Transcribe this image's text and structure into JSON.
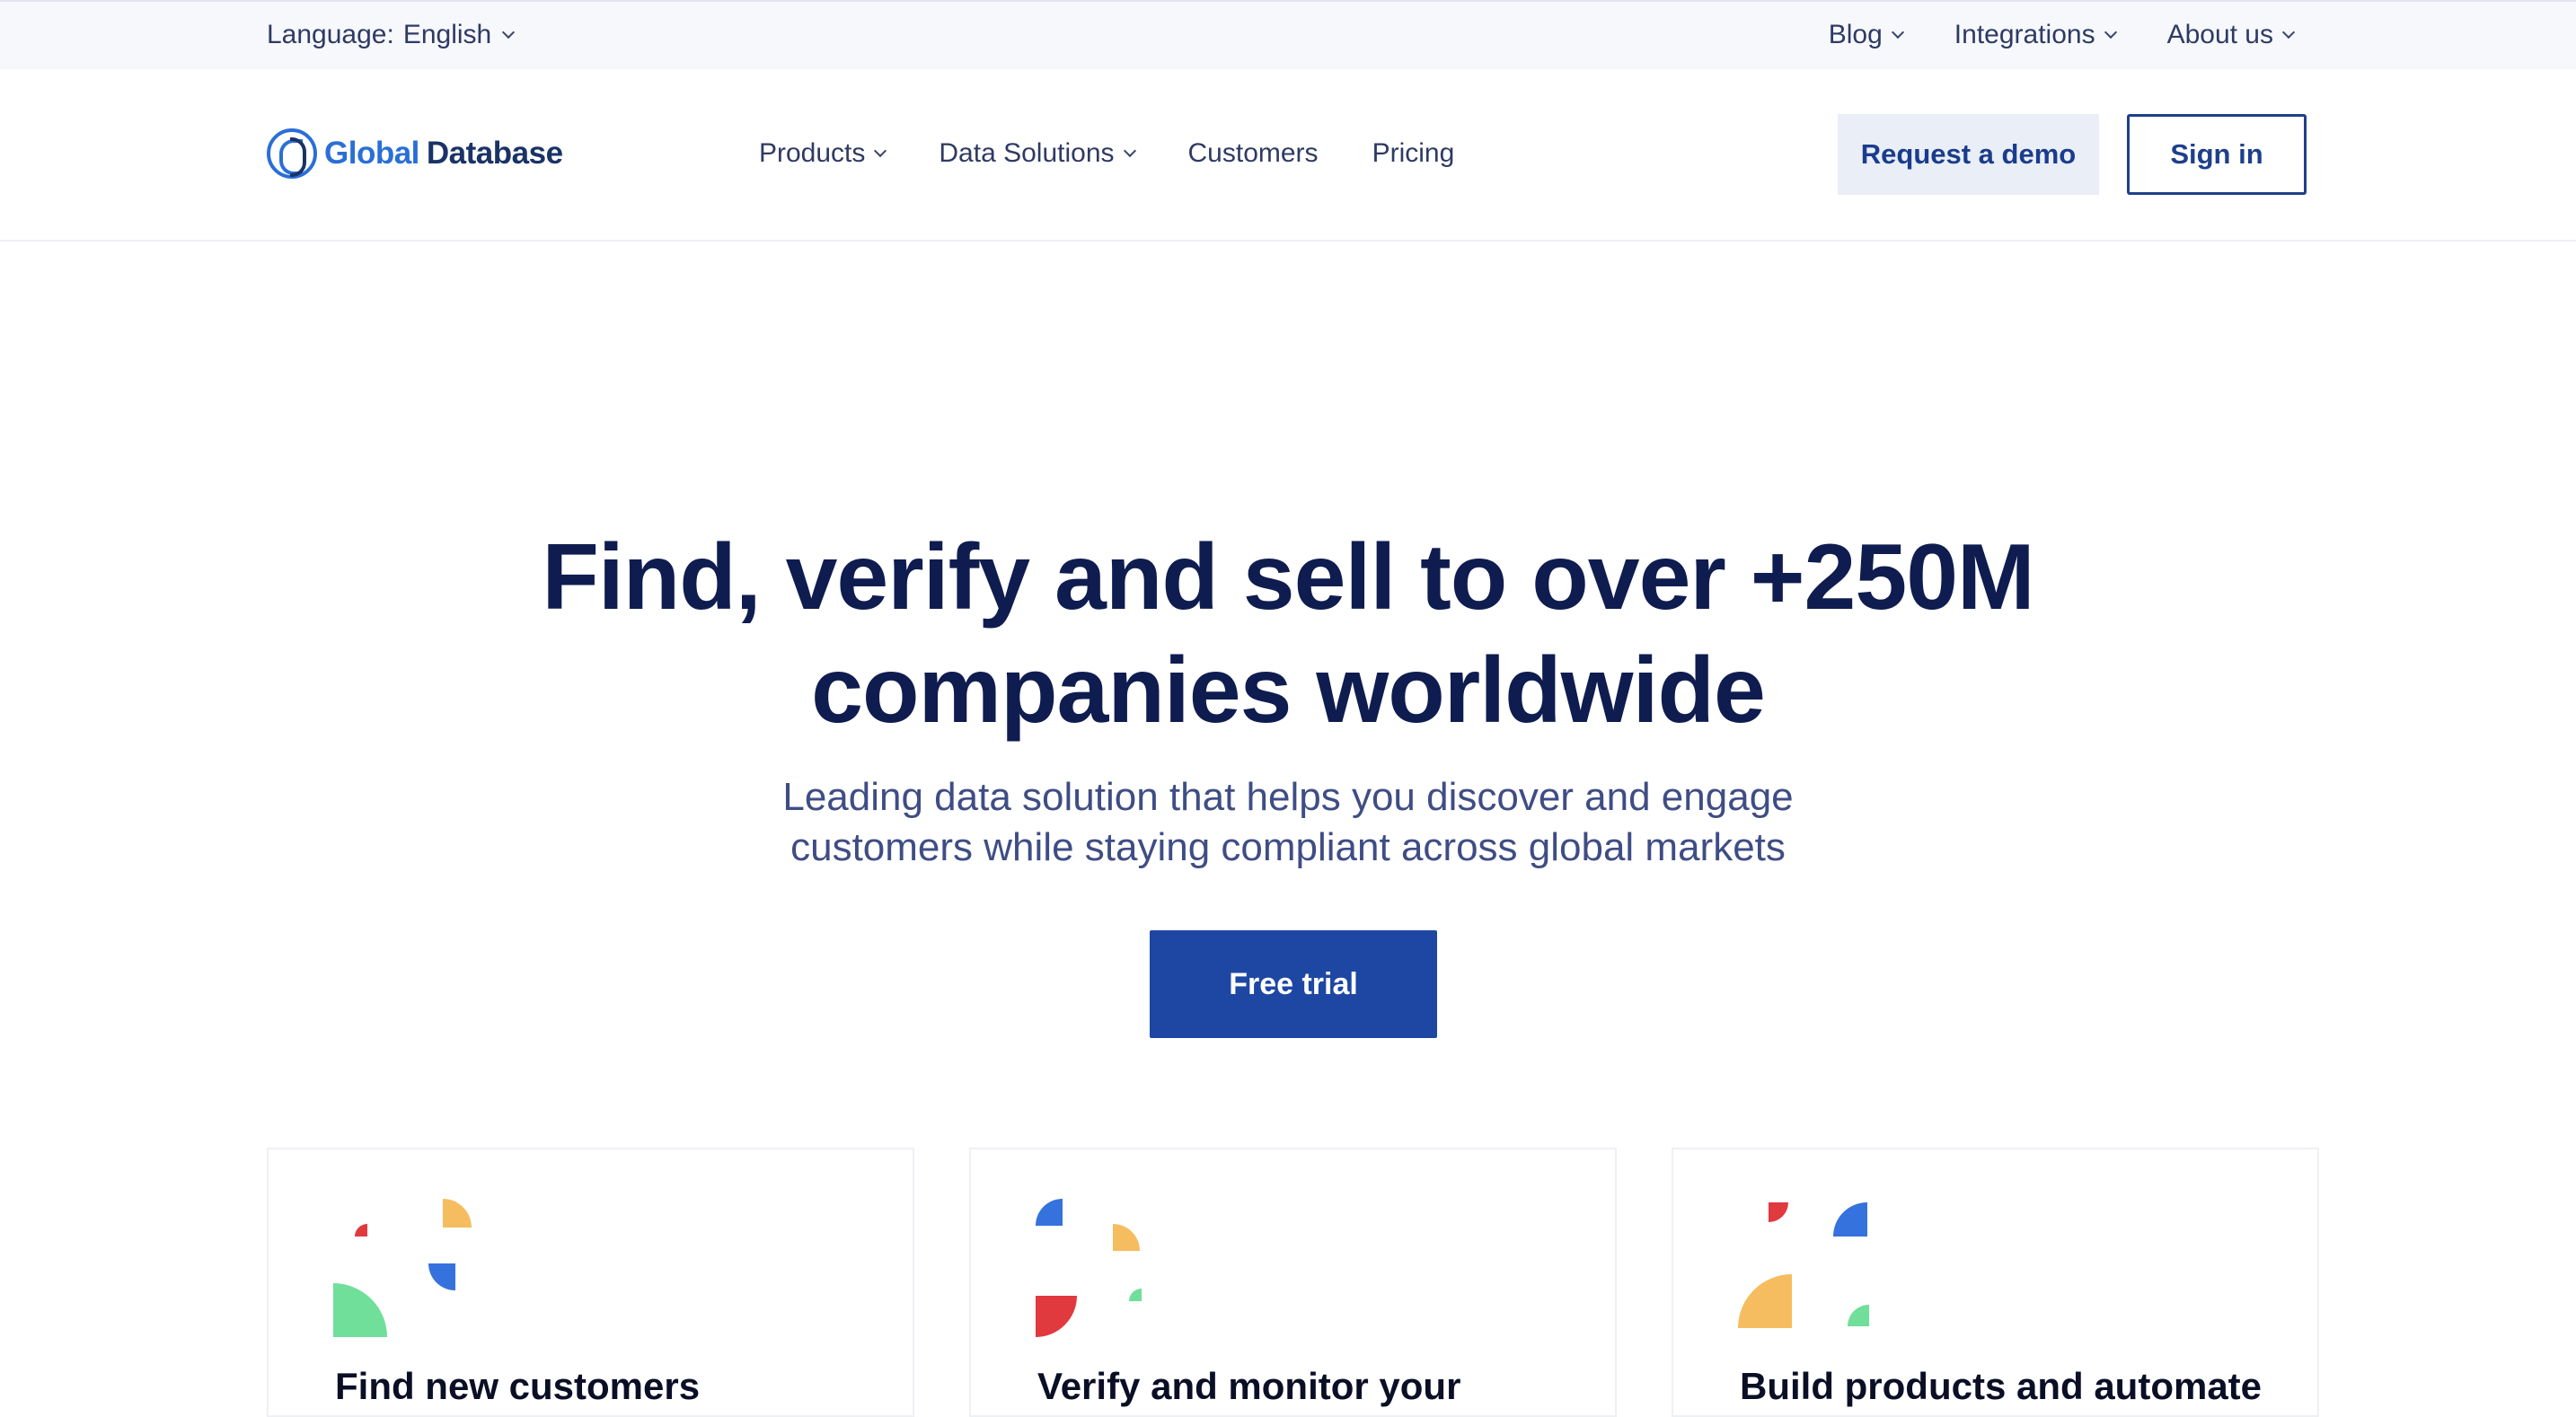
{
  "topbar": {
    "language_label": "Language:",
    "language_value": "English",
    "links": [
      {
        "label": "Blog"
      },
      {
        "label": "Integrations"
      },
      {
        "label": "About us"
      }
    ]
  },
  "nav": {
    "logo_word1": "Global",
    "logo_word2": "Database",
    "menu": [
      {
        "label": "Products",
        "dropdown": true
      },
      {
        "label": "Data Solutions",
        "dropdown": true
      },
      {
        "label": "Customers",
        "dropdown": false
      },
      {
        "label": "Pricing",
        "dropdown": false
      }
    ],
    "request_demo": "Request a demo",
    "sign_in": "Sign in"
  },
  "hero": {
    "title_line1": "Find, verify and sell to over +250M",
    "title_line2": "companies worldwide",
    "subtitle_line1": "Leading data solution that helps you discover and engage",
    "subtitle_line2": "customers while staying compliant across global markets",
    "cta": "Free trial"
  },
  "cards": [
    {
      "title": "Find new customers"
    },
    {
      "title": "Verify and monitor your"
    },
    {
      "title": "Build products and automate"
    }
  ],
  "colors": {
    "accent_blue": "#1d47a3",
    "brand_light_blue": "#2a6fd6",
    "heading_navy": "#0f1c4f",
    "shape_red": "#e0393e",
    "shape_yellow": "#f5bd5f",
    "shape_blue": "#3572dd",
    "shape_green": "#6fdf9a"
  }
}
